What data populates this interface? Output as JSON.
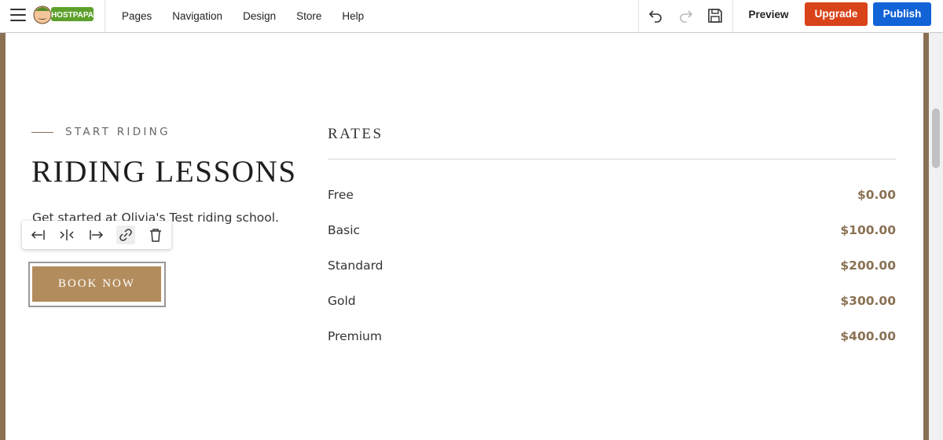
{
  "topbar": {
    "brand": "HOSTPAPA",
    "menu": [
      {
        "label": "Pages"
      },
      {
        "label": "Navigation"
      },
      {
        "label": "Design"
      },
      {
        "label": "Store"
      },
      {
        "label": "Help"
      }
    ],
    "icons": {
      "menu": "hamburger-icon",
      "undo": "undo-icon",
      "redo": "redo-icon",
      "save": "save-icon"
    },
    "preview_label": "Preview",
    "upgrade_label": "Upgrade",
    "publish_label": "Publish",
    "colors": {
      "upgrade": "#d9431a",
      "publish": "#1163d6"
    }
  },
  "section": {
    "eyebrow": "START RIDING",
    "heading": "RIDING LESSONS",
    "description": "Get started at Olivia's Test riding school.",
    "button_label": "BOOK NOW",
    "accent_color": "#b38c5d"
  },
  "element_toolbar": {
    "icons": [
      "align-left-icon",
      "align-center-icon",
      "align-right-icon",
      "link-icon",
      "trash-icon"
    ]
  },
  "rates": {
    "title": "RATES",
    "items": [
      {
        "name": "Free",
        "price": "$0.00"
      },
      {
        "name": "Basic",
        "price": "$100.00"
      },
      {
        "name": "Standard",
        "price": "$200.00"
      },
      {
        "name": "Gold",
        "price": "$300.00"
      },
      {
        "name": "Premium",
        "price": "$400.00"
      }
    ]
  }
}
